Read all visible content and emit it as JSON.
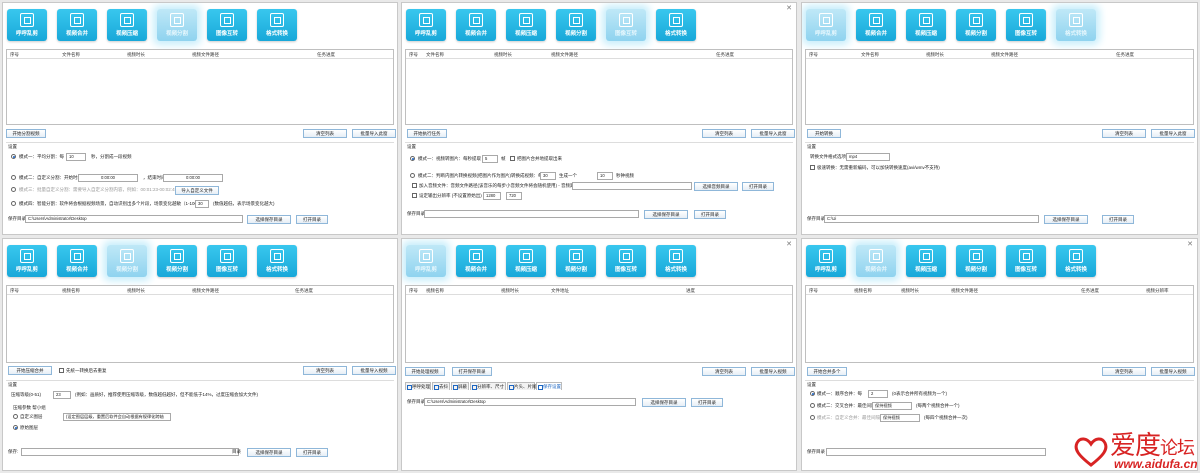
{
  "toolbar": {
    "buttons": [
      "呼呼乱剪",
      "视频合并",
      "视频压缩",
      "视频分割",
      "图像互转",
      "格式转换"
    ]
  },
  "panel1": {
    "headers": [
      "序号",
      "文件名称",
      "视频时长",
      "视频文件路径",
      "任务进度"
    ],
    "start_btn": "开始分割视频",
    "clear_btn": "清空列表",
    "import_btn": "批量导入此窗",
    "settings_label": "设置",
    "mode1_a": "模式一：平均分割：每",
    "mode1_value": "10",
    "mode1_b": "秒，分割成一段视频",
    "mode2_a": "模式二：自定义分割：开始时间",
    "mode2_start": "0:00:00",
    "mode2_end_label": "，结束时间",
    "mode2_end": "0:00:00",
    "mode3": "模式三：批量自定义分割：需要导入自定义分割内容，例如：00:01:23-00:02:48",
    "mode3_btn": "导入自定义文件",
    "mode4": "模式四：智能分割：软件将会根据视频场景，自动识别出多个片段，场景变化越敏（1-100）",
    "mode4_value": "30",
    "mode4_hint": "(数值越低，表示场景变化越大)",
    "save_label": "保存目录",
    "save_path": "C:\\Users\\Administrator\\Desktop",
    "choose_btn": "选择保存目录",
    "open_btn": "打开目录"
  },
  "panel2": {
    "headers": [
      "序号",
      "文件名称",
      "视频时长",
      "视频文件路径",
      "任务进度"
    ],
    "start_btn": "开始执行任务",
    "clear_btn": "清空列表",
    "import_btn": "批量导入此窗",
    "settings_label": "设置",
    "opt1_a": "模式一：视频转图片：每秒提取",
    "opt1_value": "5",
    "opt1_b": "帧",
    "opt1_check": "把图片合并地提取出来",
    "opt2_a": "模式二：判断内图片转换视频(把图片作为图片)转换成视频：每",
    "opt2_value": "30",
    "opt2_b": "生成一个",
    "opt2_value2": "10",
    "opt2_c": "秒钟视频",
    "opt3": "加入音频文件：音频文件路径(该音乐的每步小音频文件将会随机使用) - 音频路径",
    "opt3_btn": "选择音频目录",
    "opt3_open": "打开目录",
    "opt4": "设定输出分辨率 (不设置原始出)",
    "res_w": "1280",
    "res_h": "720",
    "save_label": "保存目录:",
    "choose_btn": "选择保存目录",
    "open_btn": "打开目录"
  },
  "panel3": {
    "headers": [
      "序号",
      "文件名称",
      "视频时长",
      "视频文件路径",
      "任务进度"
    ],
    "start_btn": "开始转换",
    "clear_btn": "清空列表",
    "import_btn": "批量导入此窗",
    "settings_label": "设置",
    "format_label": "转换文件格式选项",
    "format_value": "mp4",
    "fast_check": "极速转换：无需重新编码，可以加快转换速度(avi/wmv不支持)",
    "save_label": "保存目录",
    "save_path": "C:\\Ui",
    "choose_btn": "选择保存目录",
    "open_btn": "打开目录"
  },
  "panel4": {
    "headers": [
      "序号",
      "视频名称",
      "视频时长",
      "视频文件路径",
      "任务进度"
    ],
    "start_btn": "开始压缩合并",
    "check_label": "先统一转换后去重复",
    "clear_btn": "清空列表",
    "import_btn": "批量导入视频",
    "settings_label": "设置",
    "level_label": "压缩等级(0-51)",
    "level_value": "23",
    "level_hint": "(例如：画质好，推荐使用压缩等级，数值越低越好，但不能低于14%，过度压缩会加大文件)",
    "extra_label": "压缩参数 帮小组",
    "custom_label": "自定义图层",
    "custom_hint": "(设定图层层级，重置后软件会自动根据有规律化跨轴",
    "default_label": "原始图层",
    "save_label": "保存:",
    "dir_label": "目录",
    "choose_btn": "选择保存目录",
    "open_btn": "打开目录"
  },
  "panel5": {
    "headers": [
      "序号",
      "视频名称",
      "视频时长",
      "文件地址",
      "进度"
    ],
    "start_btn": "开始处理视频",
    "open_btn_top": "打开保存目录",
    "clear_btn": "清空列表",
    "import_btn": "批量导入视频",
    "tabs": [
      "呼呼处理",
      "去抖",
      "屏蔽",
      "分辨率、尺寸",
      "片头、片尾",
      "保存设置"
    ],
    "save_label": "保存目录",
    "save_path": "C:\\Users\\Administrator\\Desktop",
    "choose_btn": "选择保存目录",
    "open_btn": "打开目录"
  },
  "panel6": {
    "headers": [
      "序号",
      "视频名称",
      "视频时长",
      "视频文件路径",
      "任务进度",
      "视频分辨率"
    ],
    "start_btn": "开始合并多个",
    "clear_btn": "清空列表",
    "import_btn": "批量导入视频",
    "settings_label": "设置",
    "m1_a": "模式一：顺序合并：每",
    "m1_value": "2",
    "m1_b": "(0表示合并所有视频为一个)",
    "m2_a": "模式二：交叉合并：最佳间隔",
    "m2_value": "保持视频",
    "m2_hint": "(每两个视频合并一个)",
    "m3_a": "模式三：自定义合并：最佳间隔",
    "m3_value": "保持视频",
    "m3_hint": "(每四个视频合并一次)",
    "save_label": "保存目录"
  },
  "watermark": {
    "brand": "爱度",
    "suffix": "论坛",
    "url": "www.aidufa.cn"
  }
}
